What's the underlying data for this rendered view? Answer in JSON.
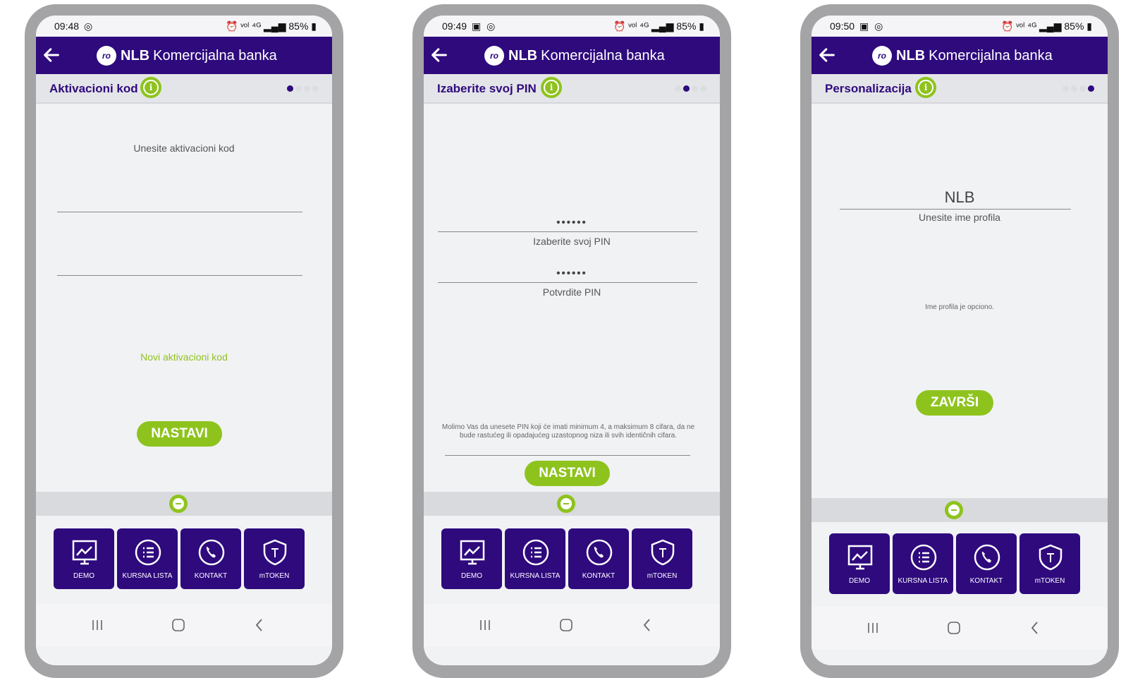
{
  "app": {
    "brand_bold": "NLB",
    "brand_rest": "Komercijalna banka",
    "logo_text": "ro"
  },
  "colors": {
    "primary": "#2e0a7d",
    "accent": "#8ec31e"
  },
  "nav": {
    "demo": "DEMO",
    "kursna": "KURSNA LISTA",
    "kontakt": "KONTAKT",
    "mtoken": "mTOKEN"
  },
  "screen1": {
    "time": "09:48",
    "battery": "85%",
    "step_title": "Aktivacioni kod",
    "prompt": "Unesite aktivacioni kod",
    "new_code_link": "Novi aktivacioni kod",
    "button": "NASTAVI",
    "active_step": 1
  },
  "screen2": {
    "time": "09:49",
    "battery": "85%",
    "step_title": "Izaberite svoj PIN",
    "pin_mask": "••••••",
    "pin_label": "Izaberite svoj PIN",
    "confirm_mask": "••••••",
    "confirm_label": "Potvrdite PIN",
    "hint": "Molimo Vas da unesete PIN koji će imati minimum 4, a maksimum 8 cifara, da ne bude rastućeg ili opadajućeg uzastopnog niza ili svih identičnih cifara.",
    "button": "NASTAVI",
    "active_step": 2
  },
  "screen3": {
    "time": "09:50",
    "battery": "85%",
    "step_title": "Personalizacija",
    "profile_value": "NLB",
    "profile_label": "Unesite ime profila",
    "optional_note": "Ime profila je opciono.",
    "button": "ZAVRŠI",
    "active_step": 4
  }
}
